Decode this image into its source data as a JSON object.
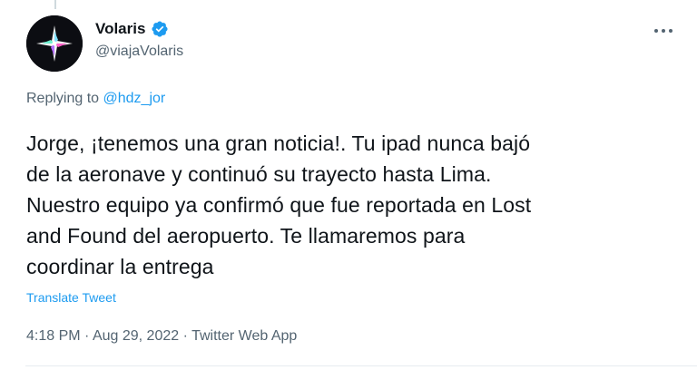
{
  "author": {
    "display_name": "Volaris",
    "handle": "@viajaVolaris",
    "verified": true
  },
  "reply_context": {
    "prefix": "Replying to",
    "mention": "@hdz_jor"
  },
  "tweet": {
    "line_1": "Jorge, ¡tenemos una gran noticia!. Tu ipad nunca bajó",
    "line_2": "de la aeronave y continuó su trayecto hasta Lima.",
    "line_3": "Nuestro equipo ya confirmó que fue reportada en Lost",
    "line_4": "and Found del aeropuerto. Te llamaremos para",
    "line_5": "coordinar la entrega"
  },
  "translate_label": "Translate Tweet",
  "meta": {
    "time": "4:18 PM",
    "separator": "·",
    "date": "Aug 29, 2022",
    "app": "Twitter Web App"
  },
  "colors": {
    "link": "#1d9bf0",
    "secondary_text": "#536471",
    "verified": "#1d9bf0"
  },
  "icons": {
    "more": "more-horizontal-icon",
    "verified": "verified-badge-icon",
    "avatar": "volaris-logo-avatar"
  }
}
